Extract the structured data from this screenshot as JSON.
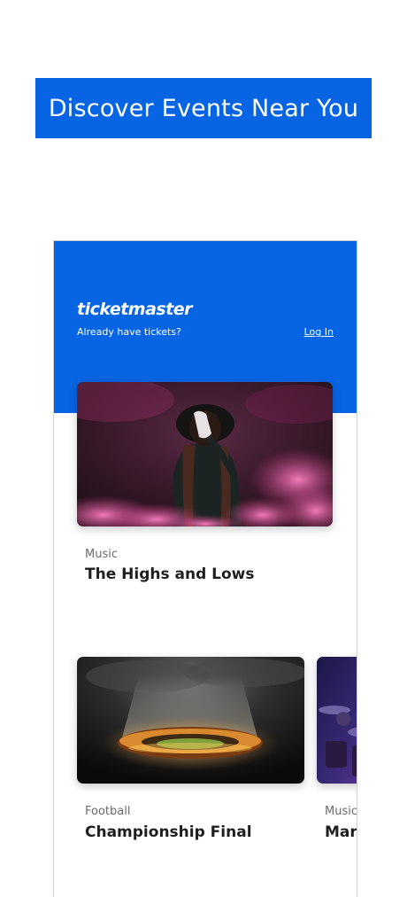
{
  "banner": {
    "title": "Discover Events Near You"
  },
  "app": {
    "logo": "ticketmaster",
    "tagline": "Already have tickets?",
    "login_label": "Log In"
  },
  "events": [
    {
      "category": "Music",
      "title": "The Highs and Lows"
    },
    {
      "category": "Football",
      "title": "Championship Final"
    },
    {
      "category": "Music",
      "title": "Mar"
    }
  ],
  "colors": {
    "brand_blue": "#0764e3"
  }
}
